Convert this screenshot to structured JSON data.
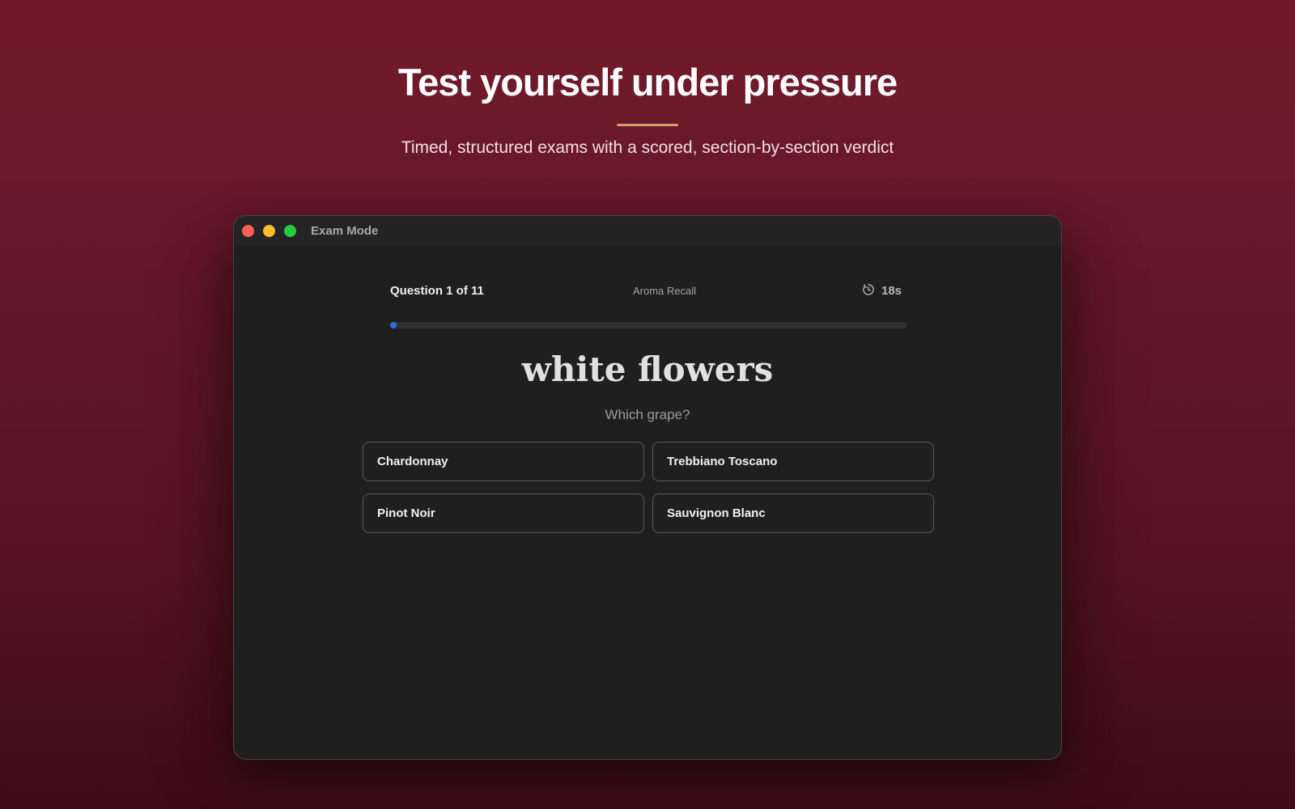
{
  "hero": {
    "title": "Test yourself under pressure",
    "subtitle": "Timed, structured exams with a scored, section-by-section verdict"
  },
  "window": {
    "title": "Exam Mode"
  },
  "exam": {
    "question_counter": "Question 1 of 11",
    "section": "Aroma Recall",
    "timer_icon": "timer-icon",
    "timer": "18s",
    "progress": 0.01,
    "prompt": "white flowers",
    "question": "Which grape?",
    "answers": [
      "Chardonnay",
      "Trebbiano Toscano",
      "Pinot Noir",
      "Sauvignon Blanc"
    ]
  },
  "colors": {
    "background": "#6a1826",
    "accent_divider": "#d9a066",
    "progress": "#2f6fd8",
    "window": "#1f1f1f"
  }
}
